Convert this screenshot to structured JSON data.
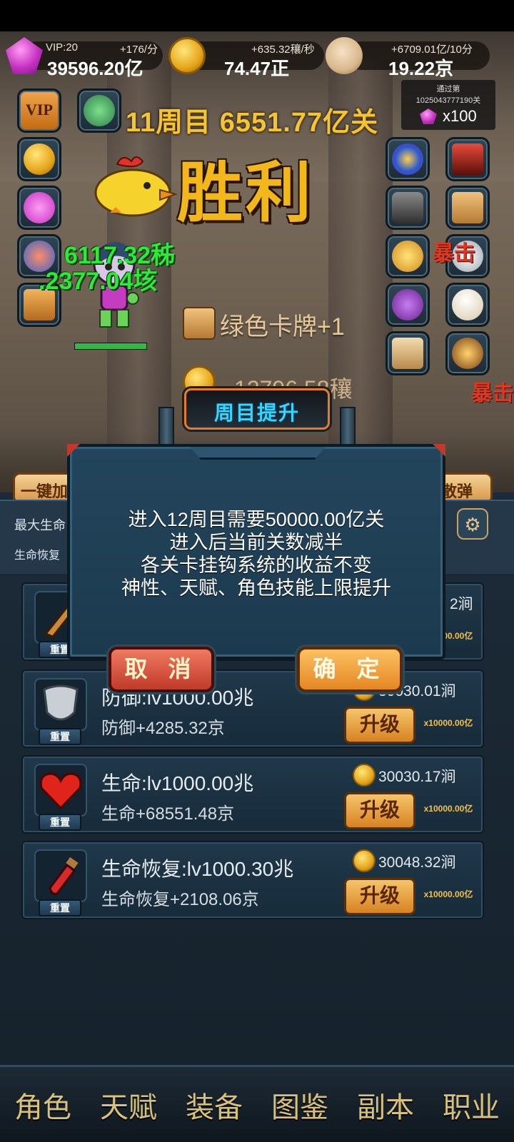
{
  "resources": {
    "gems": {
      "label": "VIP:20",
      "rate": "+176/分",
      "value": "39596.20亿"
    },
    "coins": {
      "rate": "+635.32穰/秒",
      "value": "74.47正"
    },
    "skulls": {
      "rate": "+6709.01亿/10分",
      "value": "19.22京"
    }
  },
  "stage": {
    "title": "11周目 6551.77亿关",
    "pass_label_1": "通过第",
    "pass_label_2": "1025043777190关",
    "pass_reward": "x100"
  },
  "side_buttons": {
    "vip_label": "VIP"
  },
  "battle": {
    "victory": "胜利",
    "damage_1": "6117.32秭",
    "damage_2": ".2377.04垓",
    "card_drop": "绿色卡牌+1",
    "coin_drop": "12796.58穰",
    "red_texts": [
      "暴击",
      "暴击"
    ],
    "hp_fraction": 1.0
  },
  "panel": {
    "left_tab": "一键加",
    "right_tab": "散弹",
    "stat_max_hp": "最大生命",
    "stat_regen": "生命恢复"
  },
  "dialog": {
    "title": "周目提升",
    "lines": [
      "进入12周目需要50000.00亿关",
      "进入后当前关数减半",
      "各关卡挂钩系统的收益不变",
      "神性、天赋、角色技能上限提升"
    ],
    "cancel": "取 消",
    "confirm": "确 定"
  },
  "upgrades": [
    {
      "name": "",
      "bonus": "",
      "cost": "2涧",
      "reset": "重置",
      "upgrade": "升级",
      "mult": "x10000.00亿",
      "icon": "weapon-icon"
    },
    {
      "name": "防御:lv1000.00兆",
      "bonus": "防御+4285.32京",
      "cost": "30030.01涧",
      "reset": "重置",
      "upgrade": "升级",
      "mult": "x10000.00亿",
      "icon": "shield-icon"
    },
    {
      "name": "生命:lv1000.00兆",
      "bonus": "生命+68551.48京",
      "cost": "30030.17涧",
      "reset": "重置",
      "upgrade": "升级",
      "mult": "x10000.00亿",
      "icon": "heart-icon"
    },
    {
      "name": "生命恢复:lv1000.30兆",
      "bonus": "生命恢复+2108.06京",
      "cost": "30048.32涧",
      "reset": "重置",
      "upgrade": "升级",
      "mult": "x10000.00亿",
      "icon": "potion-icon"
    }
  ],
  "nav": [
    "角色",
    "天赋",
    "装备",
    "图鉴",
    "副本",
    "职业"
  ],
  "colors": {
    "gold": "#f2b71b",
    "dialog_title": "#36d5ff",
    "damage_green": "#2ee83b"
  }
}
